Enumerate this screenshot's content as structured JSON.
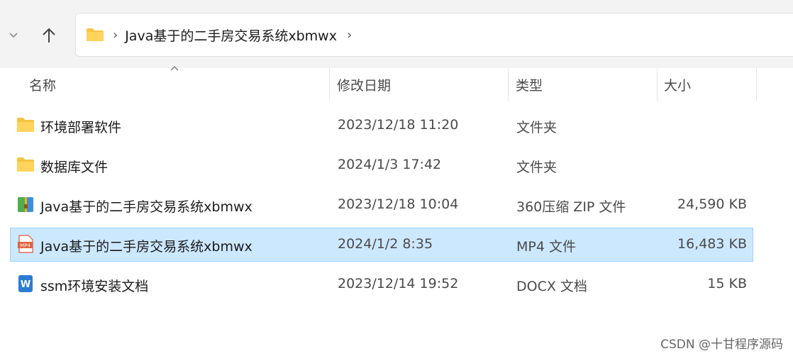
{
  "address_bar": {
    "path": "Java基于的二手房交易系统xbmwx",
    "separator": "›"
  },
  "columns": {
    "name": "名称",
    "date": "修改日期",
    "type": "类型",
    "size": "大小"
  },
  "files": [
    {
      "name": "环境部署软件",
      "date": "2023/12/18 11:20",
      "type": "文件夹",
      "size": "",
      "icon": "folder-icon"
    },
    {
      "name": "数据库文件",
      "date": "2024/1/3 17:42",
      "type": "文件夹",
      "size": "",
      "icon": "folder-icon"
    },
    {
      "name": "Java基于的二手房交易系统xbmwx",
      "date": "2023/12/18 10:04",
      "type": "360压缩 ZIP 文件",
      "size": "24,590 KB",
      "icon": "zip-archive-icon"
    },
    {
      "name": "Java基于的二手房交易系统xbmwx",
      "date": "2024/1/2 8:35",
      "type": "MP4 文件",
      "size": "16,483 KB",
      "icon": "mp4-file-icon",
      "selected": true
    },
    {
      "name": "ssm环境安装文档",
      "date": "2023/12/14 19:52",
      "type": "DOCX 文档",
      "size": "15 KB",
      "icon": "docx-file-icon"
    }
  ],
  "mp4_icon_label": "MP4",
  "docx_icon_label": "W",
  "watermark": "CSDN @十甘程序源码",
  "colors": {
    "selection_bg": "#cce8ff",
    "selection_border": "#99d1ff",
    "folder": "#f4c542"
  }
}
